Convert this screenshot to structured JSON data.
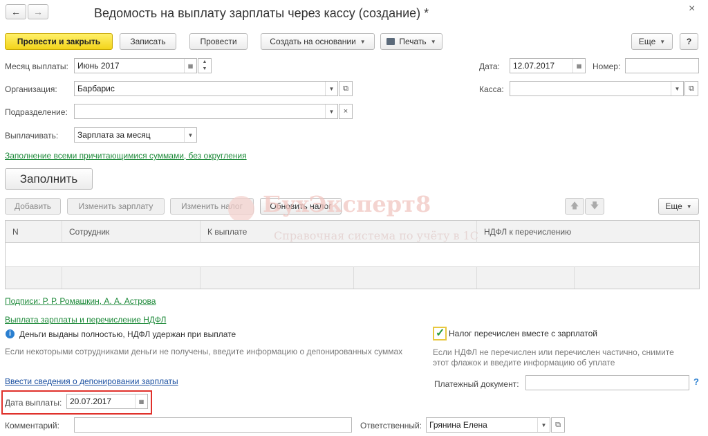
{
  "window": {
    "title": "Ведомость на выплату зарплаты через кассу (создание) *",
    "close_glyph": "×"
  },
  "toolbar": {
    "post_close": "Провести и закрыть",
    "save": "Записать",
    "post": "Провести",
    "create_based": "Создать на основании",
    "print": "Печать",
    "more": "Еще",
    "help": "?"
  },
  "form": {
    "month_label": "Месяц выплаты:",
    "month_value": "Июнь 2017",
    "org_label": "Организация:",
    "org_value": "Барбарис",
    "dept_label": "Подразделение:",
    "dept_value": "",
    "pay_label": "Выплачивать:",
    "pay_value": "Зарплата за месяц",
    "date_label": "Дата:",
    "date_value": "12.07.2017",
    "number_label": "Номер:",
    "number_value": "",
    "cash_label": "Касса:",
    "cash_value": ""
  },
  "fill_link": "Заполнение всеми причитающимися суммами, без округления",
  "fill_button": "Заполнить",
  "table_toolbar": {
    "add": "Добавить",
    "change_salary": "Изменить зарплату",
    "change_tax": "Изменить налог",
    "update_tax": "Обновить налог",
    "more": "Еще"
  },
  "table": {
    "columns": [
      "N",
      "Сотрудник",
      "К выплате",
      "НДФЛ к перечислению"
    ]
  },
  "watermark": {
    "brand": "БухЭксперт8",
    "tagline": "Справочная система по учёту в 1С"
  },
  "signatures_link": "Подписи: Р. Р. Ромашкин, А. А. Астрова",
  "payout_section": {
    "title": "Выплата зарплаты и перечисление НДФЛ",
    "info_text": "Деньги выданы полностью, НДФЛ удержан при выплате",
    "info_hint": "Если некоторыми сотрудниками деньги не получены, введите информацию о депонированных суммах",
    "deposit_link": "Ввести сведения о депонировании зарплаты",
    "tax_checkbox_label": "Налог перечислен вместе с зарплатой",
    "tax_checked": true,
    "tax_hint_line1": "Если НДФЛ не перечислен или перечислен частично, снимите",
    "tax_hint_line2": "этот флажок и введите информацию об уплате",
    "payment_doc_label": "Платежный документ:",
    "payment_doc_value": "",
    "payment_date_label": "Дата выплаты:",
    "payment_date_value": "20.07.2017"
  },
  "footer": {
    "comment_label": "Комментарий:",
    "comment_value": "",
    "responsible_label": "Ответственный:",
    "responsible_value": "Грянина Елена"
  },
  "colors": {
    "primary_button": "#f3d41a",
    "link_green": "#1e8a3a",
    "link_blue": "#1a4fa0",
    "highlight_red": "#e0302a",
    "checkbox_green": "#2a9a3a",
    "info_blue": "#2a7fd0"
  },
  "icons": {
    "back": "arrow-left-icon",
    "forward": "arrow-right-icon",
    "calendar": "calendar-icon",
    "printer": "printer-icon",
    "open": "open-icon",
    "clear": "clear-icon",
    "info": "info-icon",
    "up": "arrow-up-icon",
    "down": "arrow-down-icon"
  }
}
